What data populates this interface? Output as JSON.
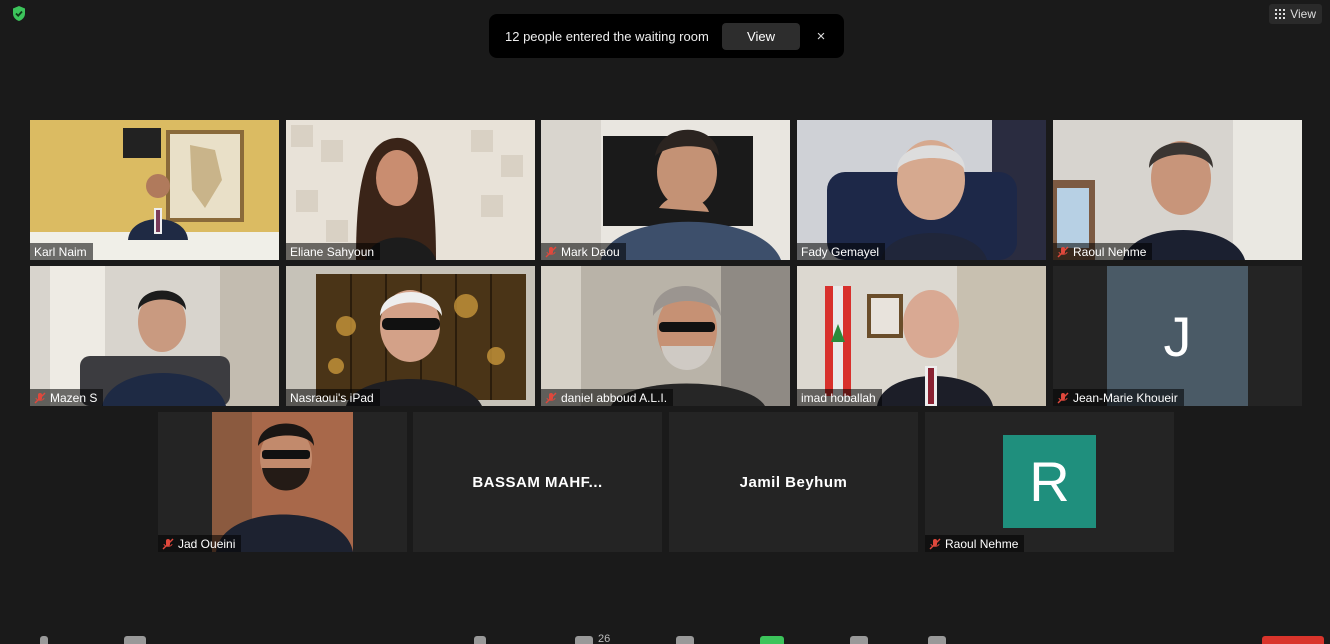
{
  "waiting_room": {
    "message": "12 people entered the waiting room",
    "view_button": "View",
    "close": "×"
  },
  "top": {
    "view_label": "View"
  },
  "tiles": [
    {
      "name": "Karl Naim",
      "muted": false
    },
    {
      "name": "Eliane Sahyoun",
      "muted": false
    },
    {
      "name": "Mark Daou",
      "muted": true
    },
    {
      "name": "Fady Gemayel",
      "muted": false
    },
    {
      "name": "Raoul Nehme",
      "muted": true
    },
    {
      "name": "Mazen S",
      "muted": true
    },
    {
      "name": "Nasraoui's iPad",
      "muted": false,
      "active": true
    },
    {
      "name": "daniel abboud A.L.I.",
      "muted": true
    },
    {
      "name": "imad hoballah",
      "muted": false
    },
    {
      "name": "Jean-Marie Khoueir",
      "muted": true,
      "avatar_letter": "J",
      "avatar_color": "#4a5a66"
    },
    {
      "name": "Jad Oueini",
      "muted": true
    },
    {
      "name": "BASSAM  MAHF..."
    },
    {
      "name": "Jamil Beyhum"
    },
    {
      "name": "Raoul Nehme",
      "muted": true,
      "avatar_letter": "R",
      "avatar_color": "#1f8f7d"
    }
  ],
  "toolbar": {
    "participants_count": "26"
  },
  "colors": {
    "active_speaker": "#c5d63a",
    "shield": "#3cc45b",
    "mute": "#e0483c"
  }
}
